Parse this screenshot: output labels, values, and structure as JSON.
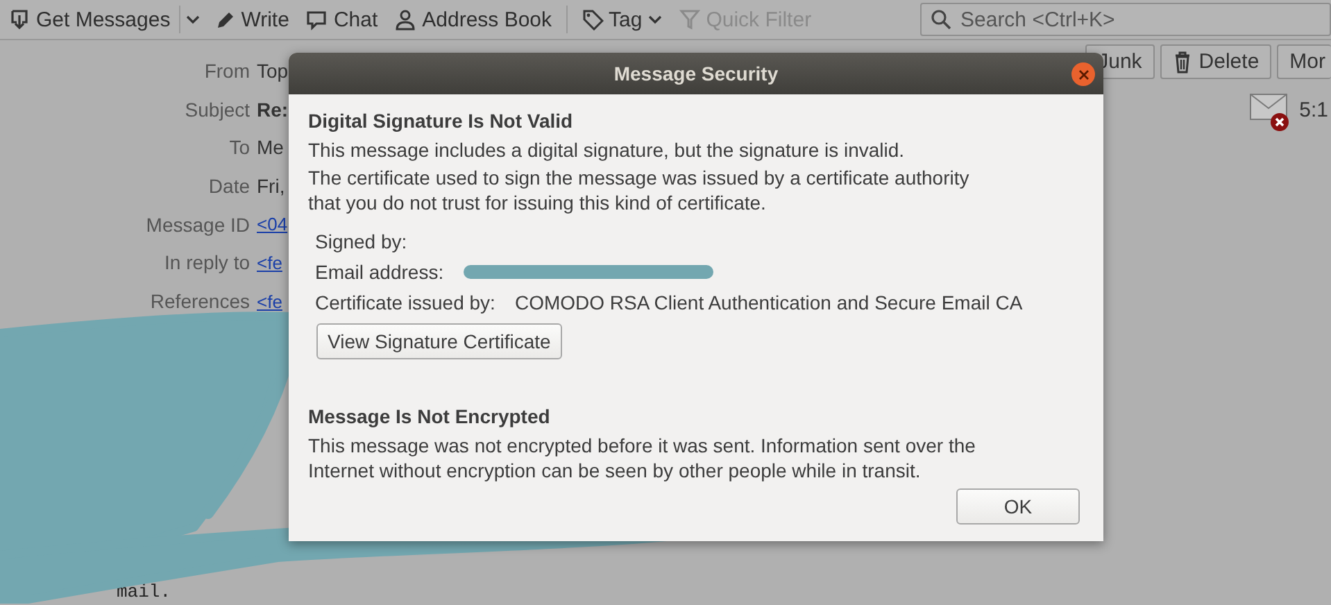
{
  "toolbar": {
    "buttons": [
      {
        "label": "Get Messages",
        "dropdown": true,
        "disabled": false
      },
      {
        "label": "Write",
        "dropdown": false,
        "disabled": false
      },
      {
        "label": "Chat",
        "dropdown": false,
        "disabled": false
      },
      {
        "label": "Address Book",
        "dropdown": false,
        "disabled": false
      },
      {
        "label": "Tag",
        "dropdown": true,
        "disabled": false
      },
      {
        "label": "Quick Filter",
        "dropdown": false,
        "disabled": true
      }
    ],
    "search": {
      "placeholder": "Search <Ctrl+K>"
    }
  },
  "header": {
    "fields": [
      {
        "label": "From",
        "value": "Top",
        "kind": "text"
      },
      {
        "label": "Subject",
        "value": "Re:",
        "kind": "bold"
      },
      {
        "label": "To",
        "value": "Me",
        "kind": "text"
      },
      {
        "label": "Date",
        "value": "Fri,",
        "kind": "text"
      },
      {
        "label": "Message ID",
        "value": "<04",
        "kind": "link"
      },
      {
        "label": "In reply to",
        "value": "<fe",
        "kind": "link"
      },
      {
        "label": "References",
        "value": "<fe",
        "kind": "link"
      }
    ],
    "actions": [
      "Junk",
      "Delete",
      "Mor"
    ],
    "time": "5:1"
  },
  "body": {
    "fragment": "mail."
  },
  "dialog": {
    "title": "Message Security",
    "signature": {
      "heading": "Digital Signature Is Not Valid",
      "lines": [
        "This message includes a digital signature, but the signature is invalid.",
        "The certificate used to sign the message was issued by a certificate authority that you do not trust for issuing this kind of certificate."
      ],
      "details": [
        {
          "label": "Signed by:"
        },
        {
          "label": "Email address:",
          "redacted": true
        },
        {
          "label": "Certificate issued by:",
          "value": "COMODO RSA Client Authentication and Secure Email CA"
        }
      ],
      "button": "View Signature Certificate"
    },
    "encryption": {
      "heading": "Message Is Not Encrypted",
      "text": "This message was not encrypted before it was sent. Information sent over the Internet without encryption can be seen by other people while in transit."
    },
    "ok": "OK"
  }
}
